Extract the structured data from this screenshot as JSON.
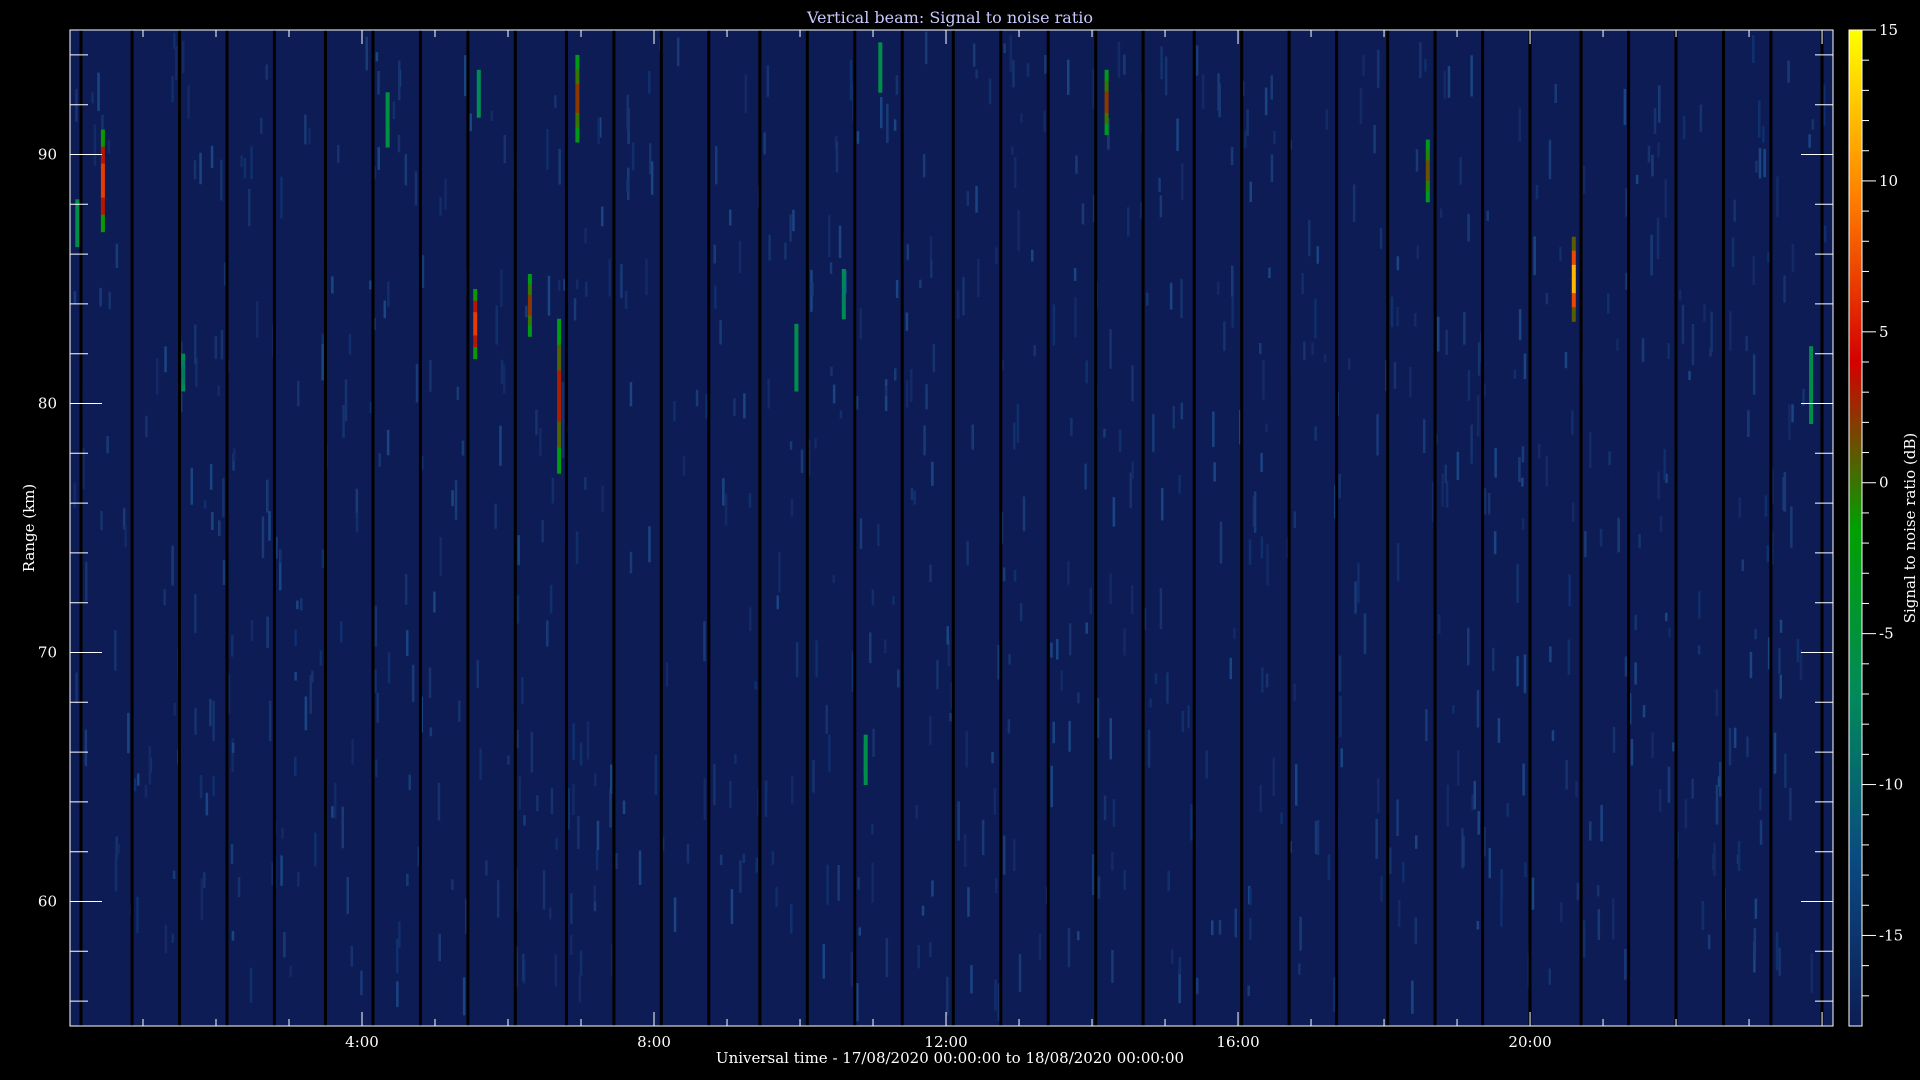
{
  "chart_data": {
    "type": "heatmap",
    "title": "Vertical beam: Signal to noise ratio",
    "xlabel": "Universal time - 17/08/2020 00:00:00 to 18/08/2020 00:00:00",
    "ylabel": "Range (km)",
    "x_unit": "hours UT",
    "xlim": [
      0,
      24.15
    ],
    "ylim": [
      55,
      95
    ],
    "x_ticks": [
      {
        "value": 4,
        "label": "4:00"
      },
      {
        "value": 8,
        "label": "8:00"
      },
      {
        "value": 12,
        "label": "12:00"
      },
      {
        "value": 16,
        "label": "16:00"
      },
      {
        "value": 20,
        "label": "20:00"
      }
    ],
    "y_ticks": [
      {
        "value": 60,
        "label": "60"
      },
      {
        "value": 70,
        "label": "70"
      },
      {
        "value": 80,
        "label": "80"
      },
      {
        "value": 90,
        "label": "90"
      }
    ],
    "colorbar": {
      "label": "Signal to noise ratio (dB)",
      "range": [
        -18,
        15
      ],
      "ticks": [
        {
          "value": 15,
          "label": "15"
        },
        {
          "value": 10,
          "label": "10"
        },
        {
          "value": 5,
          "label": "5"
        },
        {
          "value": 0,
          "label": "0"
        },
        {
          "value": -5,
          "label": "-5"
        },
        {
          "value": -10,
          "label": "-10"
        },
        {
          "value": -15,
          "label": "-15"
        }
      ],
      "colors": [
        "#0e1c55",
        "#0a4a80",
        "#008a5a",
        "#00a000",
        "#d40000",
        "#ff8000",
        "#ffff00"
      ]
    },
    "background_snr_db": -17,
    "data_gap_times_h": [
      0.15,
      0.85,
      1.5,
      2.15,
      2.8,
      3.5,
      4.15,
      4.8,
      5.45,
      6.1,
      6.8,
      7.45,
      8.1,
      8.75,
      9.45,
      10.1,
      10.75,
      11.4,
      12.1,
      12.75,
      13.4,
      14.05,
      14.7,
      15.4,
      16.05,
      16.7,
      17.35,
      18.05,
      18.7,
      19.35,
      20.0,
      20.7,
      21.35,
      22.0,
      22.65,
      23.3,
      24.0
    ],
    "echoes": [
      {
        "t": 0.1,
        "r0": 86.3,
        "r1": 88.2,
        "snr_peak": -6
      },
      {
        "t": 0.45,
        "r0": 86.9,
        "r1": 91,
        "snr_peak": 8
      },
      {
        "t": 1.55,
        "r0": 80.5,
        "r1": 82,
        "snr_peak": -9
      },
      {
        "t": 4.35,
        "r0": 90.3,
        "r1": 92.5,
        "snr_peak": -5
      },
      {
        "t": 5.55,
        "r0": 81.8,
        "r1": 84.6,
        "snr_peak": 8
      },
      {
        "t": 5.6,
        "r0": 91.5,
        "r1": 93.4,
        "snr_peak": -7
      },
      {
        "t": 6.3,
        "r0": 82.7,
        "r1": 85.2,
        "snr_peak": 3
      },
      {
        "t": 6.7,
        "r0": 77.2,
        "r1": 83.4,
        "snr_peak": 4
      },
      {
        "t": 6.95,
        "r0": 90.5,
        "r1": 94,
        "snr_peak": 3
      },
      {
        "t": 9.95,
        "r0": 80.5,
        "r1": 83.2,
        "snr_peak": -6
      },
      {
        "t": 10.6,
        "r0": 83.4,
        "r1": 85.4,
        "snr_peak": -8
      },
      {
        "t": 10.9,
        "r0": 64.7,
        "r1": 66.7,
        "snr_peak": -6
      },
      {
        "t": 11.1,
        "r0": 92.5,
        "r1": 94.5,
        "snr_peak": -6
      },
      {
        "t": 14.2,
        "r0": 90.8,
        "r1": 93.4,
        "snr_peak": 3
      },
      {
        "t": 18.6,
        "r0": 88.1,
        "r1": 90.6,
        "snr_peak": 2
      },
      {
        "t": 20.6,
        "r0": 83.3,
        "r1": 86.7,
        "snr_peak": 14
      },
      {
        "t": 23.85,
        "r0": 79.2,
        "r1": 82.3,
        "snr_peak": -6
      }
    ]
  }
}
